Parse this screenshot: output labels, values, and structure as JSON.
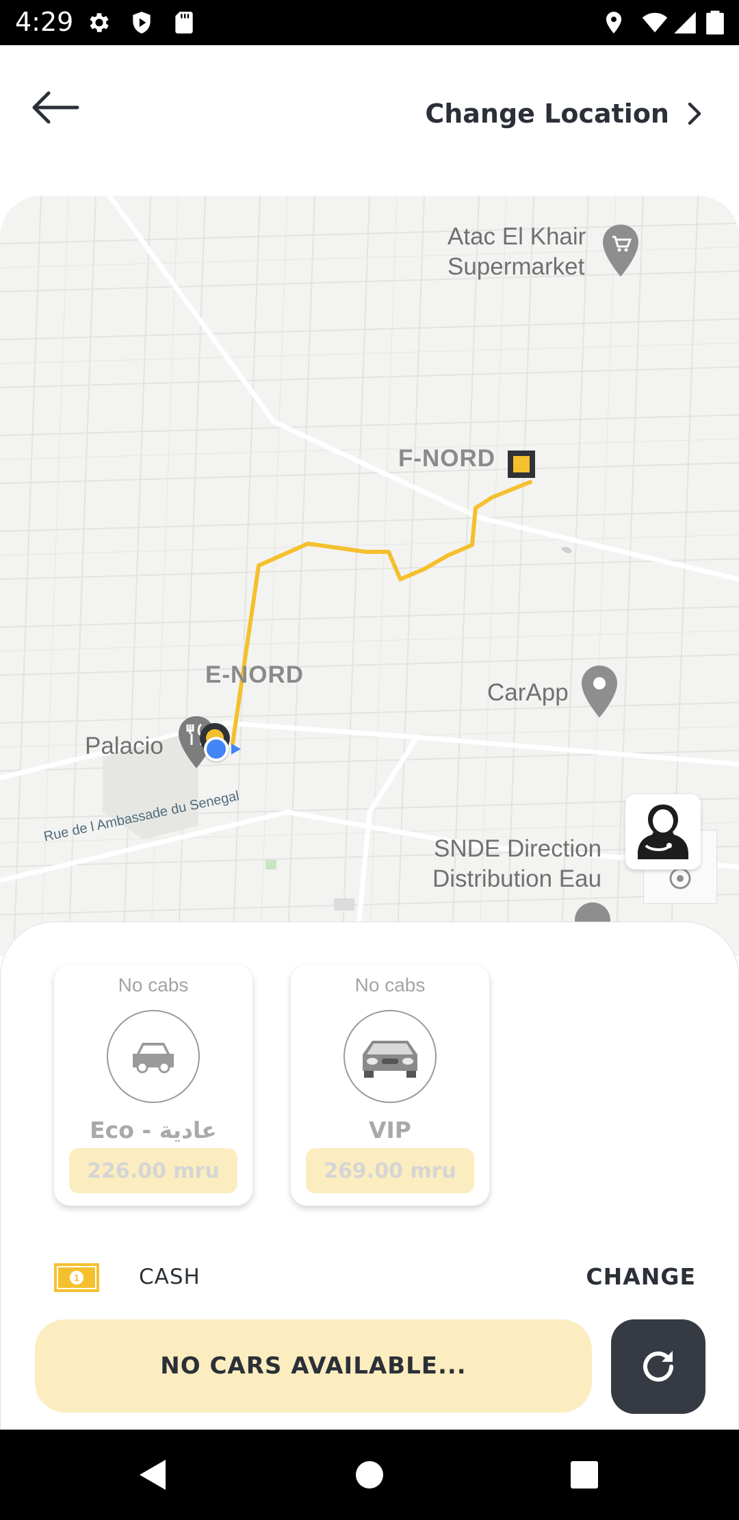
{
  "status_bar": {
    "time": "4:29",
    "left_icons": [
      "gear-icon",
      "shield-icon",
      "sd-card-icon"
    ],
    "right_icons": [
      "location-icon",
      "wifi-icon",
      "signal-icon",
      "battery-icon"
    ]
  },
  "header": {
    "back_icon": "arrow-left-icon",
    "change_location_label": "Change Location",
    "chevron_icon": "chevron-right-icon"
  },
  "map": {
    "pois": {
      "atac": "Atac El Khair\nSupermarket",
      "carapp": "CarApp",
      "palacio": "Palacio",
      "snde": "SNDE Direction\nDistribution Eau"
    },
    "areas": {
      "f_nord": "F-NORD",
      "e_nord": "E-NORD"
    },
    "street": "Rue de l Ambassade du Senegal",
    "route_color": "#f5c02e",
    "support_icon": "customer-support-icon",
    "locate_icon": "my-location-icon"
  },
  "cabs": [
    {
      "status": "No cabs",
      "name": "Eco - عادية",
      "price": "226.00 mru",
      "icon": "car-icon"
    },
    {
      "status": "No cabs",
      "name": "VIP",
      "price": "269.00 mru",
      "icon": "luxury-car-icon"
    }
  ],
  "payment": {
    "icon": "cash-icon",
    "method": "CASH",
    "change_label": "CHANGE"
  },
  "actions": {
    "no_cars": "NO CARS AVAILABLE...",
    "refresh_icon": "refresh-icon"
  },
  "nav_bar": {
    "buttons": [
      "back-triangle-icon",
      "home-circle-icon",
      "recents-square-icon"
    ]
  },
  "colors": {
    "accent": "#f5c02e",
    "accent_light": "#fbedbf",
    "dark": "#363b43"
  }
}
